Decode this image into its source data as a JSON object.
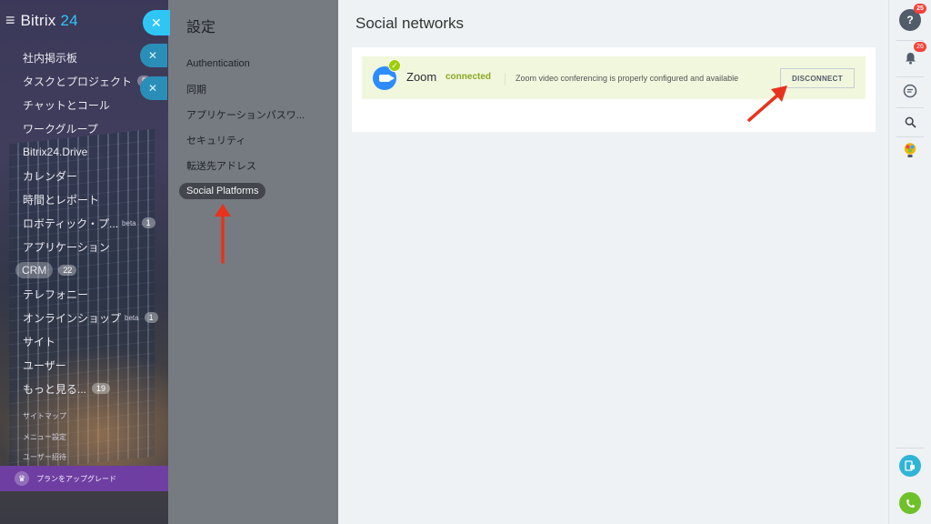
{
  "app": {
    "logo_word": "Bitrix",
    "logo_num": "24"
  },
  "sidebar": {
    "items": [
      {
        "label": "社内掲示板"
      },
      {
        "label": "タスクとプロジェクト",
        "badge": "5"
      },
      {
        "label": "チャットとコール"
      },
      {
        "label": "ワークグループ"
      },
      {
        "label": "Bitrix24.Drive"
      },
      {
        "label": "カレンダー"
      },
      {
        "label": "時間とレポート"
      },
      {
        "label": "ロボティック・プ...",
        "beta": "beta",
        "badge": "1"
      },
      {
        "label": "アプリケーション"
      },
      {
        "label": "CRM",
        "badge": "22"
      },
      {
        "label": "テレフォニー"
      },
      {
        "label": "オンラインショップ",
        "beta": "beta",
        "badge": "1"
      },
      {
        "label": "サイト"
      },
      {
        "label": "ユーザー"
      },
      {
        "label": "もっと見る...",
        "badge": "19"
      }
    ],
    "sub_links": [
      "サイトマップ",
      "メニュー設定",
      "ユーザー招待"
    ],
    "upgrade_label": "プランをアップグレード"
  },
  "settings": {
    "title": "設定",
    "close_icon": "close-icon",
    "nav": [
      {
        "label": "Authentication"
      },
      {
        "label": "同期"
      },
      {
        "label": "アプリケーションパスワ..."
      },
      {
        "label": "セキュリティ"
      },
      {
        "label": "転送先アドレス"
      },
      {
        "label": "Social Platforms",
        "active": true
      }
    ]
  },
  "main": {
    "title": "Social networks",
    "integrations": [
      {
        "name": "Zoom",
        "status": "connected",
        "description": "Zoom video conferencing is properly configured and available",
        "button": "DISCONNECT"
      }
    ]
  },
  "right_bar": {
    "help_badge": "25",
    "notifications_badge": "26"
  },
  "colors": {
    "accent": "#2fc6f6",
    "connected_green": "#8aa823",
    "zoom_blue": "#2d8cff",
    "annotation_red": "#e8321d"
  }
}
